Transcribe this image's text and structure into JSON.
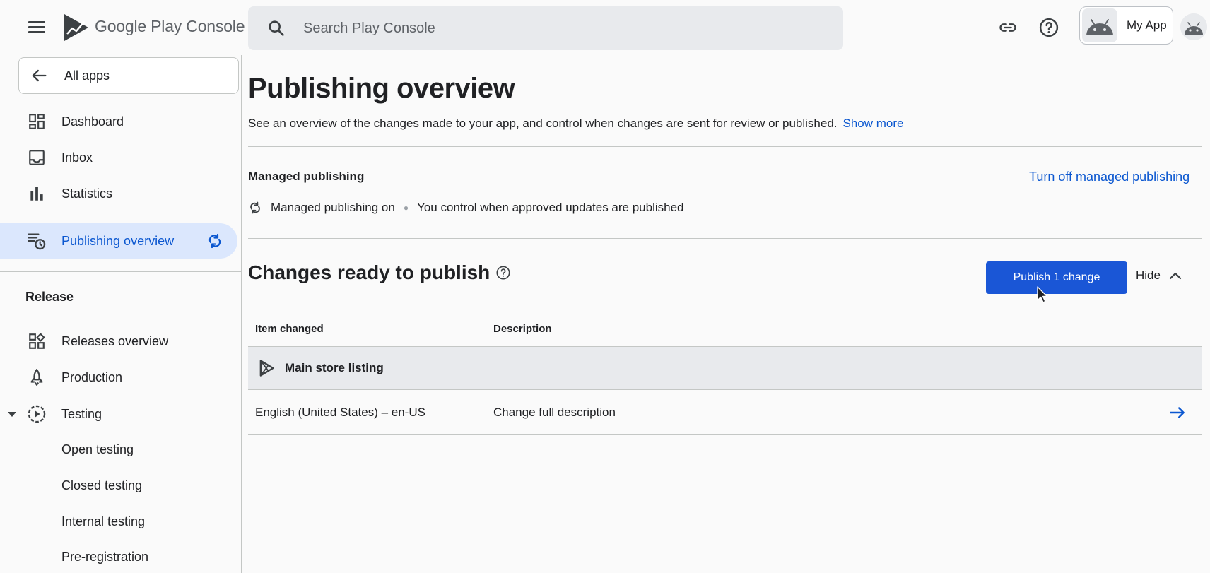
{
  "header": {
    "brand_google": "Google Play",
    "brand_console": " Console",
    "search_placeholder": "Search Play Console",
    "app_name": "My App"
  },
  "sidebar": {
    "all_apps": "All apps",
    "items": [
      {
        "label": "Dashboard",
        "icon": "dashboard-icon"
      },
      {
        "label": "Inbox",
        "icon": "inbox-icon"
      },
      {
        "label": "Statistics",
        "icon": "statistics-icon"
      },
      {
        "label": "Publishing overview",
        "icon": "publishing-overview-icon",
        "active": true
      }
    ],
    "section_release": "Release",
    "release_items": [
      {
        "label": "Releases overview",
        "icon": "releases-overview-icon"
      },
      {
        "label": "Production",
        "icon": "production-icon"
      },
      {
        "label": "Testing",
        "icon": "testing-icon"
      }
    ],
    "testing_subitems": [
      "Open testing",
      "Closed testing",
      "Internal testing",
      "Pre-registration"
    ]
  },
  "main": {
    "title": "Publishing overview",
    "description": "See an overview of the changes made to your app, and control when changes are sent for review or published.",
    "show_more": "Show more",
    "managed_publishing": {
      "title": "Managed publishing",
      "turn_off_link": "Turn off managed publishing",
      "status": "Managed publishing on",
      "status_detail": "You control when approved updates are published"
    },
    "changes": {
      "title": "Changes ready to publish",
      "publish_button": "Publish 1 change",
      "hide_button": "Hide",
      "columns": [
        "Item changed",
        "Description"
      ],
      "group_label": "Main store listing",
      "rows": [
        {
          "item": "English (United States) – en-US",
          "description": "Change full description"
        }
      ]
    }
  },
  "colors": {
    "accent": "#0b57d0",
    "publish_button": "#1a56d6",
    "active_nav_bg": "#dbe7fd"
  }
}
